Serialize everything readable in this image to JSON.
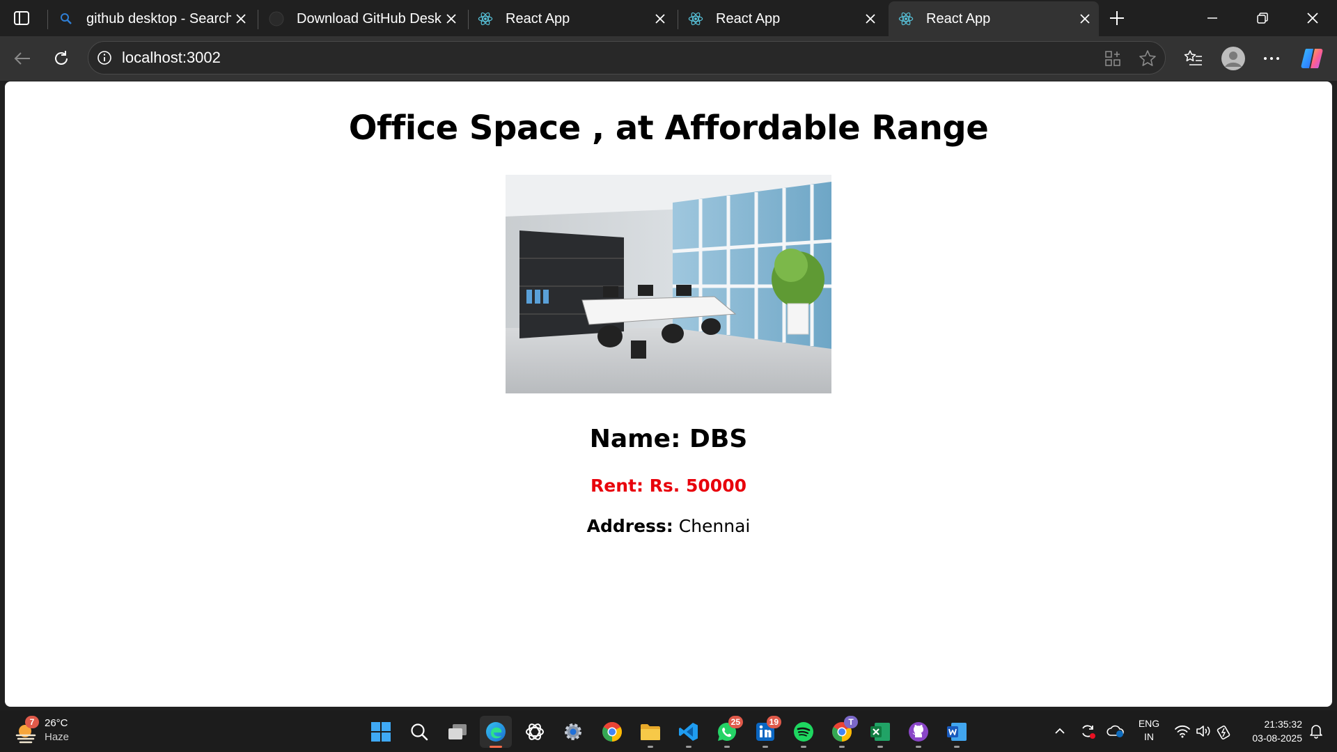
{
  "browser": {
    "tabs": [
      {
        "title": "github desktop - Search",
        "icon": "search-icon",
        "active": false
      },
      {
        "title": "Download GitHub Desktop",
        "icon": "github-icon",
        "active": false
      },
      {
        "title": "React App",
        "icon": "react-icon",
        "active": false
      },
      {
        "title": "React App",
        "icon": "react-icon",
        "active": false
      },
      {
        "title": "React App",
        "icon": "react-icon",
        "active": true
      }
    ],
    "address": {
      "url": "localhost:3002"
    }
  },
  "page": {
    "heading": "Office Space , at Affordable Range",
    "image_alt": "Office Space",
    "name_line": "Name: DBS",
    "rent_line": "Rent: Rs. 50000",
    "address_label": "Address:",
    "address_value": " Chennai",
    "rent_color": "#e8000b"
  },
  "taskbar": {
    "weather": {
      "temp": "26°C",
      "condition": "Haze",
      "badge": "7"
    },
    "badges": {
      "whatsapp": "25",
      "linkedin": "19",
      "chrome_profile": "T"
    },
    "language": {
      "line1": "ENG",
      "line2": "IN"
    },
    "clock": {
      "time": "21:35:32",
      "date": "03-08-2025"
    }
  }
}
